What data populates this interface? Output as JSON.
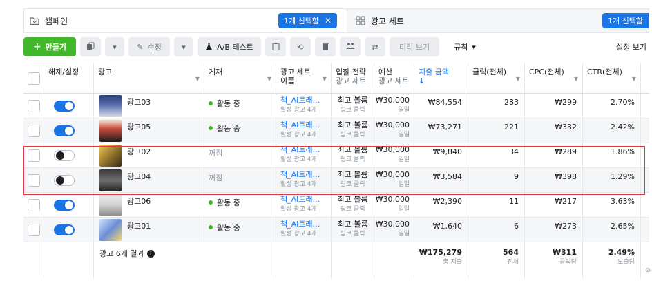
{
  "tabs": {
    "campaign_label": "캠페인",
    "adset_label": "광고 세트",
    "selected_pill": "1개 선택함",
    "adset_pill": "1개 선택함"
  },
  "toolbar": {
    "create_label": "만들기",
    "edit_label": "수정",
    "ab_test_label": "A/B 테스트",
    "preview_label": "미리 보기",
    "rules_label": "규칙",
    "settings_label": "설정 보기"
  },
  "columns": {
    "toggle": "해제/설정",
    "name": "광고",
    "delivery": "게재",
    "adset_l1": "광고 세트",
    "adset_l2": "이름",
    "bid_l1": "입찰 전략",
    "bid_l2": "광고 세트",
    "budget_l1": "예산",
    "budget_l2": "광고 세트",
    "spend_l1": "지출 금액",
    "spend_arrow": "↓",
    "clicks": "클릭(전체)",
    "cpc": "CPC(전체)",
    "ctr": "CTR(전체)"
  },
  "rows": [
    {
      "on": true,
      "name": "광고03",
      "delivery": "활동 중",
      "adset": "책_AI트래...",
      "adset_sub": "활성 광고 4개",
      "bid": "최고 볼륨",
      "bid_sub": "링크 클릭",
      "budget": "₩30,000",
      "budget_sub": "일일",
      "spend": "₩84,554",
      "clicks": "283",
      "cpc": "₩299",
      "ctr": "2.70%"
    },
    {
      "on": true,
      "name": "광고05",
      "delivery": "활동 중",
      "adset": "책_AI트래...",
      "adset_sub": "활성 광고 4개",
      "bid": "최고 볼륨",
      "bid_sub": "링크 클릭",
      "budget": "₩30,000",
      "budget_sub": "일일",
      "spend": "₩73,271",
      "clicks": "221",
      "cpc": "₩332",
      "ctr": "2.42%"
    },
    {
      "on": false,
      "name": "광고02",
      "delivery": "꺼짐",
      "adset": "책_AI트래...",
      "adset_sub": "활성 광고 4개",
      "bid": "최고 볼륨",
      "bid_sub": "링크 클릭",
      "budget": "₩30,000",
      "budget_sub": "일일",
      "spend": "₩9,840",
      "clicks": "34",
      "cpc": "₩289",
      "ctr": "1.86%"
    },
    {
      "on": false,
      "name": "광고04",
      "delivery": "꺼짐",
      "adset": "책_AI트래...",
      "adset_sub": "활성 광고 4개",
      "bid": "최고 볼륨",
      "bid_sub": "링크 클릭",
      "budget": "₩30,000",
      "budget_sub": "일일",
      "spend": "₩3,584",
      "clicks": "9",
      "cpc": "₩398",
      "ctr": "1.29%"
    },
    {
      "on": true,
      "name": "광고06",
      "delivery": "활동 중",
      "adset": "책_AI트래...",
      "adset_sub": "활성 광고 4개",
      "bid": "최고 볼륨",
      "bid_sub": "링크 클릭",
      "budget": "₩30,000",
      "budget_sub": "일일",
      "spend": "₩2,390",
      "clicks": "11",
      "cpc": "₩217",
      "ctr": "3.63%"
    },
    {
      "on": true,
      "name": "광고01",
      "delivery": "활동 중",
      "adset": "책_AI트래...",
      "adset_sub": "활성 광고 4개",
      "bid": "최고 볼륨",
      "bid_sub": "링크 클릭",
      "budget": "₩30,000",
      "budget_sub": "일일",
      "spend": "₩1,640",
      "clicks": "6",
      "cpc": "₩273",
      "ctr": "2.65%"
    }
  ],
  "footer": {
    "label": "광고 6개 결과",
    "spend": "₩175,279",
    "spend_sub": "총 지출",
    "clicks": "564",
    "clicks_sub": "전체",
    "cpc": "₩311",
    "cpc_sub": "클릭당",
    "ctr": "2.49%",
    "ctr_sub": "노출당"
  },
  "colors": {
    "accent": "#1b74e4",
    "create": "#42b72a",
    "active_dot": "#42b72a",
    "highlight": "#e0393e"
  },
  "icons": [
    "campaign-folder-icon",
    "adset-grid-icon",
    "close-icon",
    "plus-icon",
    "duplicate-icon",
    "pencil-icon",
    "beaker-icon",
    "clipboard-icon",
    "undo-icon",
    "trash-icon",
    "people-icon",
    "share-icon",
    "chevron-down-icon",
    "info-icon"
  ]
}
